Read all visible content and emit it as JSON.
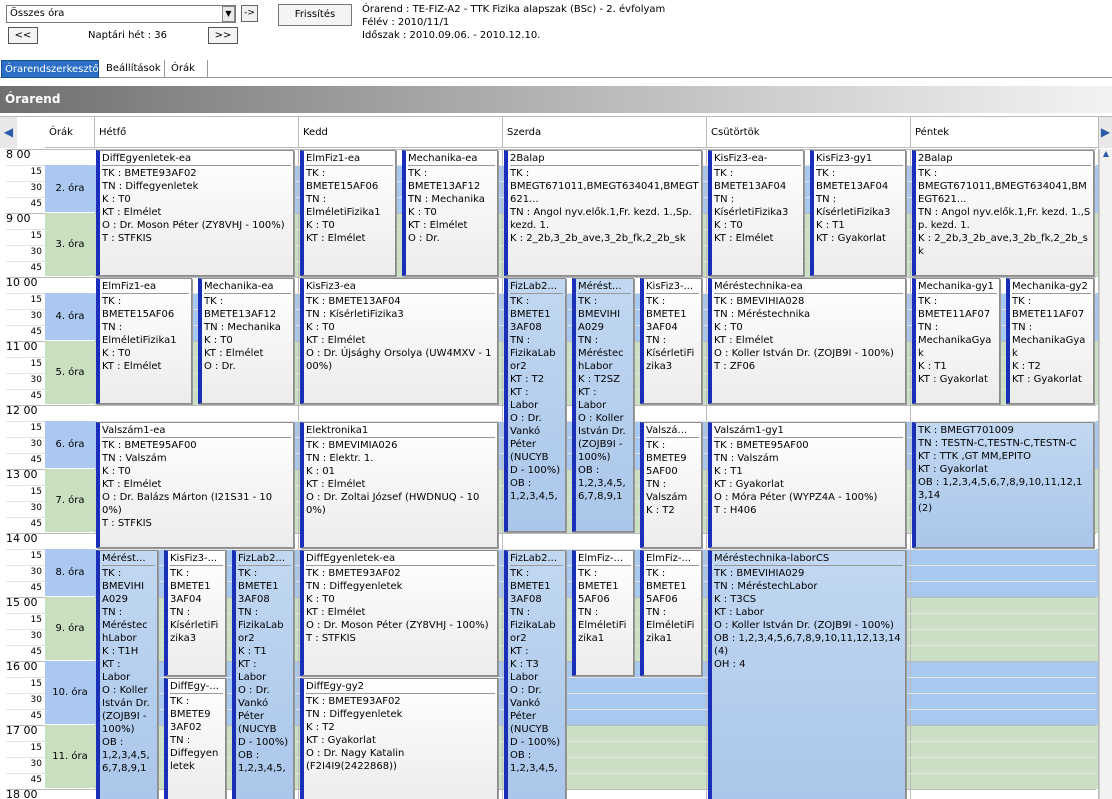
{
  "top": {
    "select_value": "Összes óra",
    "go_label": "->",
    "refresh_label": "Frissítés",
    "prev_label": "<<",
    "next_label": ">>",
    "week_label": "Naptári hét : 36",
    "info": [
      "Órarend : TE-FIZ-A2 - TTK Fizika alapszak (BSc) - 2. évfolyam",
      "Félév : 2010/11/1",
      "Időszak : 2010.09.06. - 2010.12.10."
    ]
  },
  "tabs": [
    "Órarendszerkesztő",
    "Beállítások",
    "Órák"
  ],
  "banner": "Órarend",
  "grid": {
    "orak_header": "Órák",
    "days": [
      "Hétfő",
      "Kedd",
      "Szerda",
      "Csütörtök",
      "Péntek"
    ],
    "hours": [
      "8",
      "9",
      "10",
      "11",
      "12",
      "13",
      "14",
      "15",
      "16",
      "17",
      "18"
    ],
    "periods": [
      "2. óra",
      "3. óra",
      "4. óra",
      "5. óra",
      "6. óra",
      "7. óra",
      "8. óra",
      "9. óra",
      "10. óra",
      "11. óra"
    ],
    "events": [
      {
        "day": 0,
        "col": 0,
        "cols": 1,
        "s": 0,
        "e": 8,
        "title": "DiffEgyenletek-ea",
        "lines": [
          "TK : BMETE93AF02",
          "TN : Diffegyenletek",
          "K : T0",
          "KT : Elmélet",
          "O : Dr. Moson Péter (ZY8VHJ - 100%)",
          "T : STFKIS"
        ]
      },
      {
        "day": 1,
        "col": 0,
        "cols": 2,
        "s": 0,
        "e": 8,
        "title": "ElmFiz1-ea",
        "lines": [
          "TK :",
          "BMETE15AF06",
          "TN :",
          "ElméletiFizika1",
          "K : T0",
          "KT : Elmélet"
        ]
      },
      {
        "day": 1,
        "col": 1,
        "cols": 2,
        "s": 0,
        "e": 8,
        "title": "Mechanika-ea",
        "lines": [
          "TK :",
          "BMETE13AF12",
          "TN : Mechanika",
          "K : T0",
          "KT : Elmélet",
          "O : Dr."
        ]
      },
      {
        "day": 2,
        "col": 0,
        "cols": 1,
        "s": 0,
        "e": 8,
        "title": "2Balap",
        "lines": [
          "TK :",
          "BMEGT671011,BMEGT634041,BMEGT621...",
          "TN : Angol nyv.elők.1,Fr. kezd. 1.,Sp. kezd. 1.",
          "K : 2_2b,3_2b_ave,3_2b_fk,2_2b_sk"
        ]
      },
      {
        "day": 3,
        "col": 0,
        "cols": 2,
        "s": 0,
        "e": 8,
        "title": "KisFiz3-ea-",
        "lines": [
          "TK :",
          "BMETE13AF04",
          "TN :",
          "KísérletiFizika3",
          "K : T0",
          "KT : Elmélet"
        ]
      },
      {
        "day": 3,
        "col": 1,
        "cols": 2,
        "s": 0,
        "e": 8,
        "title": "KisFiz3-gy1",
        "lines": [
          "TK :",
          "BMETE13AF04",
          "TN :",
          "KísérletiFizika3",
          "K : T1",
          "KT : Gyakorlat"
        ]
      },
      {
        "day": 4,
        "col": 0,
        "cols": 1,
        "s": 0,
        "e": 8,
        "title": "2Balap",
        "lines": [
          "TK :",
          "BMEGT671011,BMEGT634041,BMEGT621...",
          "TN : Angol nyv.elők.1,Fr. kezd. 1.,Sp. kezd. 1.",
          "K : 2_2b,3_2b_ave,3_2b_fk,2_2b_sk"
        ]
      },
      {
        "day": 0,
        "col": 0,
        "cols": 2,
        "s": 8,
        "e": 16,
        "title": "ElmFiz1-ea",
        "lines": [
          "TK :",
          "BMETE15AF06",
          "TN :",
          "ElméletiFizika1",
          "K : T0",
          "KT : Elmélet"
        ]
      },
      {
        "day": 0,
        "col": 1,
        "cols": 2,
        "s": 8,
        "e": 16,
        "title": "Mechanika-ea",
        "lines": [
          "TK :",
          "BMETE13AF12",
          "TN : Mechanika",
          "K : T0",
          "KT : Elmélet",
          "O : Dr."
        ]
      },
      {
        "day": 1,
        "col": 0,
        "cols": 1,
        "s": 8,
        "e": 16,
        "title": "KisFiz3-ea",
        "lines": [
          "TK : BMETE13AF04",
          "TN : KísérletiFizika3",
          "K : T0",
          "KT : Elmélet",
          "O : Dr. Újsághy Orsolya (UW4MXV - 100%)"
        ]
      },
      {
        "day": 2,
        "col": 0,
        "cols": 3,
        "s": 8,
        "e": 24,
        "blue": true,
        "title": "FizLab2...",
        "lines": [
          "TK :",
          "BMETE1",
          "3AF08",
          "TN :",
          "FizikaLab",
          "or2",
          "KT : T2",
          "KT :",
          "Labor",
          "O : Dr.",
          "Vankó",
          "Péter",
          "(NUCYB",
          "D - 100%)",
          "OB :",
          "1,2,3,4,5,"
        ]
      },
      {
        "day": 2,
        "col": 1,
        "cols": 3,
        "s": 8,
        "e": 24,
        "blue": true,
        "title": "Mérést...",
        "lines": [
          "TK :",
          "BMEVIHI",
          "A029",
          "TN :",
          "Méréstec",
          "hLabor",
          "K : T2SZ",
          "KT :",
          "Labor",
          "O : Koller",
          "István Dr.",
          "(ZOJB9I -",
          "100%)",
          "OB :",
          "1,2,3,4,5,",
          "6,7,8,9,1"
        ]
      },
      {
        "day": 2,
        "col": 2,
        "cols": 3,
        "s": 8,
        "e": 16,
        "title": "KisFiz3-...",
        "lines": [
          "TK :",
          "BMETE1",
          "3AF04",
          "TN :",
          "KísérletiFi",
          "zika3"
        ]
      },
      {
        "day": 3,
        "col": 0,
        "cols": 1,
        "s": 8,
        "e": 16,
        "title": "Méréstechnika-ea",
        "lines": [
          "TK : BMEVIHIA028",
          "TN : Méréstechnika",
          "K : T0",
          "KT : Elmélet",
          "O : Koller István Dr. (ZOJB9I - 100%)",
          "T : ZF06"
        ]
      },
      {
        "day": 4,
        "col": 0,
        "cols": 2,
        "s": 8,
        "e": 16,
        "title": "Mechanika-gy1",
        "lines": [
          "TK :",
          "BMETE11AF07",
          "TN :",
          "MechanikaGyak",
          "K : T1",
          "KT : Gyakorlat"
        ]
      },
      {
        "day": 4,
        "col": 1,
        "cols": 2,
        "s": 8,
        "e": 16,
        "title": "Mechanika-gy2",
        "lines": [
          "TK :",
          "BMETE11AF07",
          "TN :",
          "MechanikaGyak",
          "K : T2",
          "KT : Gyakorlat"
        ]
      },
      {
        "day": 0,
        "col": 0,
        "cols": 1,
        "s": 17,
        "e": 25,
        "title": "Valszám1-ea",
        "lines": [
          "TK : BMETE95AF00",
          "TN : Valszám",
          "K : T0",
          "KT : Elmélet",
          "O : Dr. Balázs Márton (I21S31 - 100%)",
          "T : STFKIS"
        ]
      },
      {
        "day": 1,
        "col": 0,
        "cols": 1,
        "s": 17,
        "e": 25,
        "title": "Elektronika1",
        "lines": [
          "TK : BMEVIMIA026",
          "TN : Elektr. 1.",
          "K : 01",
          "KT : Elmélet",
          "O : Dr. Zoltai József (HWDNUQ - 100%)"
        ]
      },
      {
        "day": 2,
        "col": 2,
        "cols": 3,
        "s": 17,
        "e": 25,
        "title": "Valszá...",
        "lines": [
          "TK :",
          "BMETE9",
          "5AF00",
          "TN :",
          "Valszám",
          "K : T2"
        ]
      },
      {
        "day": 3,
        "col": 0,
        "cols": 1,
        "s": 17,
        "e": 25,
        "title": "Valszám1-gy1",
        "lines": [
          "TK : BMETE95AF00",
          "TN : Valszám",
          "K : T1",
          "KT : Gyakorlat",
          "O : Móra Péter (WYPZ4A - 100%)",
          "T : H406"
        ]
      },
      {
        "day": 4,
        "col": 0,
        "cols": 1,
        "s": 17,
        "e": 25,
        "blue": true,
        "title": "",
        "lines": [
          "TK : BMEGT701009",
          "TN : TESTN-C,TESTN-C,TESTN-C",
          "KT : TTK ,GT MM,EPITO",
          "KT : Gyakorlat",
          "OB : 1,2,3,4,5,6,7,8,9,10,11,12,13,14",
          "(2)"
        ]
      },
      {
        "day": 0,
        "col": 0,
        "cols": 3,
        "s": 25,
        "e": 41,
        "blue": true,
        "title": "Mérést...",
        "lines": [
          "TK :",
          "BMEVIHI",
          "A029",
          "TN :",
          "Méréstec",
          "hLabor",
          "K : T1H",
          "KT :",
          "Labor",
          "O : Koller",
          "István Dr.",
          "(ZOJB9I -",
          "100%)",
          "OB :",
          "1,2,3,4,5,",
          "6,7,8,9,1"
        ]
      },
      {
        "day": 0,
        "col": 1,
        "cols": 3,
        "s": 25,
        "e": 33,
        "title": "KisFiz3-...",
        "lines": [
          "TK :",
          "BMETE1",
          "3AF04",
          "TN :",
          "KísérletiFi",
          "zika3"
        ]
      },
      {
        "day": 0,
        "col": 2,
        "cols": 3,
        "s": 25,
        "e": 41,
        "blue": true,
        "title": "FizLab2...",
        "lines": [
          "TK :",
          "BMETE1",
          "3AF08",
          "TN :",
          "FizikaLab",
          "or2",
          "K : T1",
          "KT :",
          "Labor",
          "O : Dr.",
          "Vankó",
          "Péter",
          "(NUCYB",
          "D - 100%)",
          "OB :",
          "1,2,3,4,5,"
        ]
      },
      {
        "day": 1,
        "col": 0,
        "cols": 1,
        "s": 25,
        "e": 33,
        "title": "DiffEgyenletek-ea",
        "lines": [
          "TK : BMETE93AF02",
          "TN : Diffegyenletek",
          "K : T0",
          "KT : Elmélet",
          "O : Dr. Moson Péter (ZY8VHJ - 100%)",
          "T : STFKIS"
        ]
      },
      {
        "day": 2,
        "col": 0,
        "cols": 3,
        "s": 25,
        "e": 41,
        "blue": true,
        "title": "FizLab2...",
        "lines": [
          "TK :",
          "BMETE1",
          "3AF08",
          "TN :",
          "FizikaLab",
          "or2",
          "KT :",
          "K : T3",
          "Labor",
          "O : Dr.",
          "Vankó",
          "Péter",
          "(NUCYB",
          "D - 100%)",
          "OB :",
          "1,2,3,4,5,"
        ]
      },
      {
        "day": 2,
        "col": 1,
        "cols": 3,
        "s": 25,
        "e": 33,
        "title": "ElmFiz-...",
        "lines": [
          "TK :",
          "BMETE1",
          "5AF06",
          "TN :",
          "ElméletiFi",
          "zika1"
        ]
      },
      {
        "day": 2,
        "col": 2,
        "cols": 3,
        "s": 25,
        "e": 33,
        "title": "ElmFiz-...",
        "lines": [
          "TK :",
          "BMETE1",
          "5AF06",
          "TN :",
          "ElméletiFi",
          "zika1"
        ]
      },
      {
        "day": 3,
        "col": 0,
        "cols": 1,
        "s": 25,
        "e": 41,
        "blue": true,
        "title": "Méréstechnika-laborCS",
        "lines": [
          "TK : BMEVIHIA029",
          "TN : MéréstechLabor",
          "K : T3CS",
          "KT : Labor",
          "O : Koller István Dr. (ZOJB9I - 100%)",
          "OB : 1,2,3,4,5,6,7,8,9,10,11,12,13,14",
          "(4)",
          "OH : 4"
        ]
      },
      {
        "day": 0,
        "col": 1,
        "cols": 3,
        "s": 33,
        "e": 41,
        "title": "DiffEgy-...",
        "lines": [
          "TK :",
          "BMETE9",
          "3AF02",
          "TN :",
          "Diffegyen",
          "letek"
        ]
      },
      {
        "day": 1,
        "col": 0,
        "cols": 1,
        "s": 33,
        "e": 41,
        "title": "DiffEgy-gy2",
        "lines": [
          "TK : BMETE93AF02",
          "TN : Diffegyenletek",
          "K : T2",
          "KT : Gyakorlat",
          "O : Dr. Nagy Katalin",
          "(F2I4I9(2422868))"
        ]
      }
    ]
  }
}
